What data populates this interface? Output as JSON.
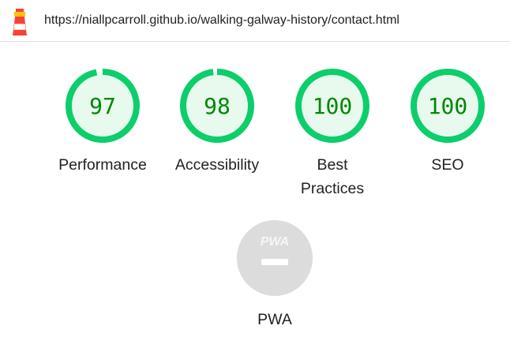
{
  "header": {
    "url": "https://niallpcarroll.github.io/walking-galway-history/contact.html",
    "logo_icon": "lighthouse-icon"
  },
  "colors": {
    "pass_ring": "#0cce6b",
    "pass_fill": "#e8f9ee",
    "pass_text": "#008800",
    "pwa_badge": "#dcdcdc"
  },
  "categories": [
    {
      "label": "Performance",
      "score": "97",
      "fraction": 0.97
    },
    {
      "label": "Accessibility",
      "score": "98",
      "fraction": 0.98
    },
    {
      "label": "Best Practices",
      "score": "100",
      "fraction": 1.0
    },
    {
      "label": "SEO",
      "score": "100",
      "fraction": 1.0
    }
  ],
  "pwa": {
    "badge_text": "PWA",
    "label": "PWA",
    "icon": "pwa-badge-icon"
  }
}
